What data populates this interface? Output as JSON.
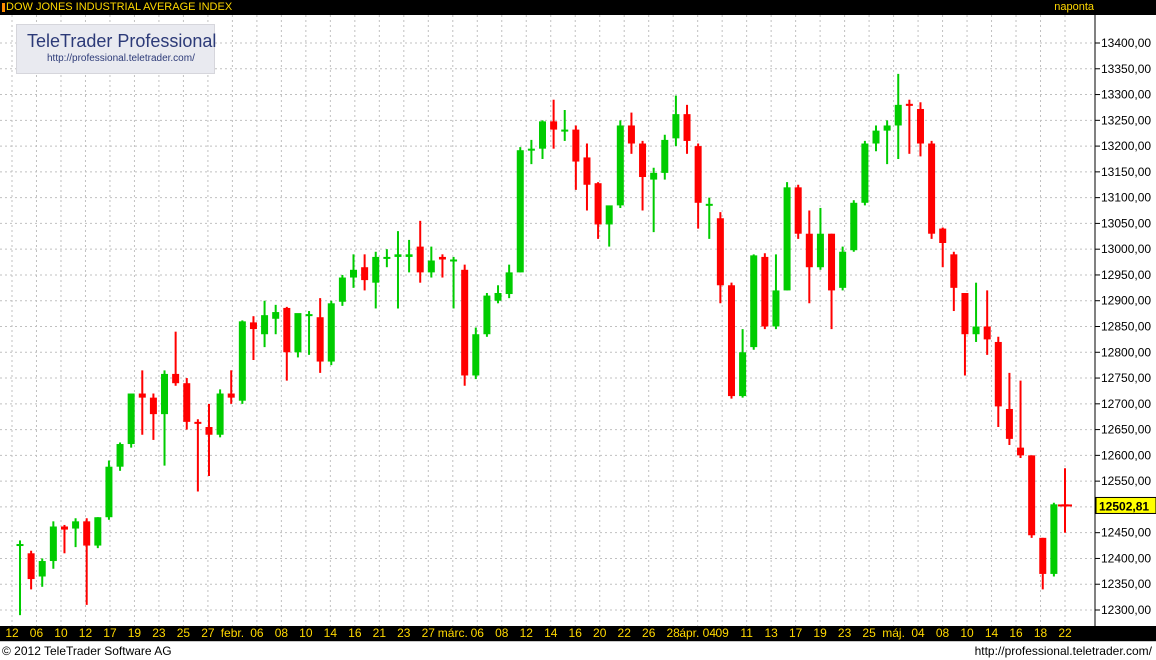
{
  "header": {
    "title": "DOW JONES INDUSTRIAL AVERAGE INDEX",
    "period": "naponta"
  },
  "logo": {
    "title": "TeleTrader Professional",
    "url": "http://professional.teletrader.com/"
  },
  "footer": {
    "copyright": "© 2012 TeleTrader Software AG",
    "url": "http://professional.teletrader.com/"
  },
  "colors": {
    "up": "#00cc00",
    "down": "#ff0000",
    "grid": "#c0c0c0",
    "label": "#ffd800",
    "last_bg": "#ffff00"
  },
  "chart_data": {
    "type": "candlestick",
    "title": "DOW JONES INDUSTRIAL AVERAGE INDEX",
    "ylim": [
      12280,
      13420
    ],
    "yticks": [
      12300,
      12350,
      12400,
      12450,
      12500,
      12550,
      12600,
      12650,
      12700,
      12750,
      12800,
      12850,
      12900,
      12950,
      13000,
      13050,
      13100,
      13150,
      13200,
      13250,
      13300,
      13350,
      13400
    ],
    "ytick_labels": [
      "12300,00",
      "12350,00",
      "12400,00",
      "12450,00",
      "12500,00",
      "12550,00",
      "12600,00",
      "12650,00",
      "12700,00",
      "12750,00",
      "12800,00",
      "12850,00",
      "12900,00",
      "12950,00",
      "13000,00",
      "13050,00",
      "13100,00",
      "13150,00",
      "13200,00",
      "13250,00",
      "13300,00",
      "13350,00",
      "13400,00"
    ],
    "xtick_labels": [
      "12",
      "06",
      "10",
      "12",
      "17",
      "19",
      "23",
      "25",
      "27",
      "febr.",
      "06",
      "08",
      "10",
      "14",
      "16",
      "21",
      "23",
      "27",
      "márc.",
      "06",
      "08",
      "12",
      "14",
      "16",
      "20",
      "22",
      "26",
      "28",
      "ápr. 04",
      "09",
      "11",
      "13",
      "17",
      "19",
      "23",
      "25",
      "máj.",
      "04",
      "08",
      "10",
      "14",
      "16",
      "18",
      "22"
    ],
    "last_value": 12502.81,
    "last_label": "12502,81",
    "grid": true,
    "candles": [
      {
        "o": 12428,
        "h": 12435,
        "l": 12290,
        "c": 12428
      },
      {
        "o": 12410,
        "h": 12415,
        "l": 12340,
        "c": 12360
      },
      {
        "o": 12365,
        "h": 12400,
        "l": 12345,
        "c": 12395
      },
      {
        "o": 12395,
        "h": 12472,
        "l": 12380,
        "c": 12462
      },
      {
        "o": 12462,
        "h": 12465,
        "l": 12410,
        "c": 12456
      },
      {
        "o": 12458,
        "h": 12478,
        "l": 12422,
        "c": 12472
      },
      {
        "o": 12472,
        "h": 12478,
        "l": 12310,
        "c": 12425
      },
      {
        "o": 12425,
        "h": 12480,
        "l": 12420,
        "c": 12480
      },
      {
        "o": 12480,
        "h": 12590,
        "l": 12475,
        "c": 12578
      },
      {
        "o": 12578,
        "h": 12625,
        "l": 12570,
        "c": 12622
      },
      {
        "o": 12622,
        "h": 12720,
        "l": 12615,
        "c": 12720
      },
      {
        "o": 12720,
        "h": 12765,
        "l": 12640,
        "c": 12712
      },
      {
        "o": 12712,
        "h": 12720,
        "l": 12630,
        "c": 12680
      },
      {
        "o": 12680,
        "h": 12765,
        "l": 12580,
        "c": 12758
      },
      {
        "o": 12758,
        "h": 12840,
        "l": 12735,
        "c": 12740
      },
      {
        "o": 12740,
        "h": 12750,
        "l": 12650,
        "c": 12665
      },
      {
        "o": 12665,
        "h": 12670,
        "l": 12530,
        "c": 12662
      },
      {
        "o": 12655,
        "h": 12700,
        "l": 12560,
        "c": 12640
      },
      {
        "o": 12640,
        "h": 12728,
        "l": 12635,
        "c": 12720
      },
      {
        "o": 12720,
        "h": 12765,
        "l": 12700,
        "c": 12712
      },
      {
        "o": 12706,
        "h": 12862,
        "l": 12700,
        "c": 12860
      },
      {
        "o": 12858,
        "h": 12870,
        "l": 12785,
        "c": 12845
      },
      {
        "o": 12835,
        "h": 12900,
        "l": 12810,
        "c": 12872
      },
      {
        "o": 12865,
        "h": 12892,
        "l": 12835,
        "c": 12878
      },
      {
        "o": 12886,
        "h": 12888,
        "l": 12745,
        "c": 12800
      },
      {
        "o": 12800,
        "h": 12875,
        "l": 12790,
        "c": 12876
      },
      {
        "o": 12872,
        "h": 12880,
        "l": 12795,
        "c": 12874
      },
      {
        "o": 12868,
        "h": 12905,
        "l": 12760,
        "c": 12782
      },
      {
        "o": 12782,
        "h": 12900,
        "l": 12775,
        "c": 12895
      },
      {
        "o": 12898,
        "h": 12950,
        "l": 12890,
        "c": 12945
      },
      {
        "o": 12945,
        "h": 12990,
        "l": 12925,
        "c": 12960
      },
      {
        "o": 12965,
        "h": 12990,
        "l": 12920,
        "c": 12940
      },
      {
        "o": 12935,
        "h": 12995,
        "l": 12885,
        "c": 12985
      },
      {
        "o": 12985,
        "h": 13000,
        "l": 12965,
        "c": 12985
      },
      {
        "o": 12985,
        "h": 13035,
        "l": 12885,
        "c": 12990
      },
      {
        "o": 12985,
        "h": 13018,
        "l": 12955,
        "c": 12990
      },
      {
        "o": 13005,
        "h": 13055,
        "l": 12935,
        "c": 12955
      },
      {
        "o": 12955,
        "h": 13005,
        "l": 12945,
        "c": 12978
      },
      {
        "o": 12985,
        "h": 12990,
        "l": 12945,
        "c": 12980
      },
      {
        "o": 12980,
        "h": 12985,
        "l": 12885,
        "c": 12980
      },
      {
        "o": 12960,
        "h": 12970,
        "l": 12735,
        "c": 12755
      },
      {
        "o": 12755,
        "h": 12848,
        "l": 12748,
        "c": 12835
      },
      {
        "o": 12835,
        "h": 12915,
        "l": 12830,
        "c": 12910
      },
      {
        "o": 12900,
        "h": 12930,
        "l": 12895,
        "c": 12915
      },
      {
        "o": 12913,
        "h": 12970,
        "l": 12905,
        "c": 12955
      },
      {
        "o": 12955,
        "h": 13198,
        "l": 12955,
        "c": 13192
      },
      {
        "o": 13192,
        "h": 13212,
        "l": 13165,
        "c": 13195
      },
      {
        "o": 13195,
        "h": 13250,
        "l": 13175,
        "c": 13248
      },
      {
        "o": 13248,
        "h": 13290,
        "l": 13195,
        "c": 13232
      },
      {
        "o": 13232,
        "h": 13270,
        "l": 13210,
        "c": 13232
      },
      {
        "o": 13232,
        "h": 13240,
        "l": 13115,
        "c": 13170
      },
      {
        "o": 13178,
        "h": 13205,
        "l": 13075,
        "c": 13125
      },
      {
        "o": 13128,
        "h": 13130,
        "l": 13020,
        "c": 13048
      },
      {
        "o": 13048,
        "h": 13075,
        "l": 13005,
        "c": 13085
      },
      {
        "o": 13085,
        "h": 13250,
        "l": 13080,
        "c": 13240
      },
      {
        "o": 13240,
        "h": 13265,
        "l": 13185,
        "c": 13205
      },
      {
        "o": 13205,
        "h": 13210,
        "l": 13075,
        "c": 13140
      },
      {
        "o": 13135,
        "h": 13158,
        "l": 13033,
        "c": 13148
      },
      {
        "o": 13148,
        "h": 13222,
        "l": 13135,
        "c": 13212
      },
      {
        "o": 13215,
        "h": 13298,
        "l": 13200,
        "c": 13262
      },
      {
        "o": 13262,
        "h": 13280,
        "l": 13185,
        "c": 13210
      },
      {
        "o": 13200,
        "h": 13205,
        "l": 13040,
        "c": 13090
      },
      {
        "o": 13088,
        "h": 13100,
        "l": 13020,
        "c": 13088
      },
      {
        "o": 13060,
        "h": 13072,
        "l": 12895,
        "c": 12930
      },
      {
        "o": 12930,
        "h": 12935,
        "l": 12710,
        "c": 12715
      },
      {
        "o": 12715,
        "h": 12845,
        "l": 12712,
        "c": 12800
      },
      {
        "o": 12810,
        "h": 12990,
        "l": 12805,
        "c": 12988
      },
      {
        "o": 12985,
        "h": 12992,
        "l": 12845,
        "c": 12850
      },
      {
        "o": 12850,
        "h": 12990,
        "l": 12845,
        "c": 12920
      },
      {
        "o": 12920,
        "h": 13130,
        "l": 12920,
        "c": 13120
      },
      {
        "o": 13120,
        "h": 13125,
        "l": 13020,
        "c": 13030
      },
      {
        "o": 13030,
        "h": 13075,
        "l": 12895,
        "c": 12965
      },
      {
        "o": 12965,
        "h": 13080,
        "l": 12960,
        "c": 13030
      },
      {
        "o": 13030,
        "h": 13030,
        "l": 12845,
        "c": 12920
      },
      {
        "o": 12925,
        "h": 13005,
        "l": 12920,
        "c": 12995
      },
      {
        "o": 12998,
        "h": 13095,
        "l": 12995,
        "c": 13090
      },
      {
        "o": 13090,
        "h": 13210,
        "l": 13085,
        "c": 13205
      },
      {
        "o": 13205,
        "h": 13240,
        "l": 13190,
        "c": 13230
      },
      {
        "o": 13230,
        "h": 13250,
        "l": 13165,
        "c": 13240
      },
      {
        "o": 13240,
        "h": 13340,
        "l": 13175,
        "c": 13280
      },
      {
        "o": 13282,
        "h": 13290,
        "l": 13185,
        "c": 13278
      },
      {
        "o": 13272,
        "h": 13285,
        "l": 13180,
        "c": 13205
      },
      {
        "o": 13205,
        "h": 13210,
        "l": 13020,
        "c": 13030
      },
      {
        "o": 13040,
        "h": 13042,
        "l": 12965,
        "c": 13012
      },
      {
        "o": 12990,
        "h": 12995,
        "l": 12880,
        "c": 12925
      },
      {
        "o": 12915,
        "h": 12915,
        "l": 12755,
        "c": 12835
      },
      {
        "o": 12835,
        "h": 12935,
        "l": 12820,
        "c": 12850
      },
      {
        "o": 12850,
        "h": 12920,
        "l": 12795,
        "c": 12825
      },
      {
        "o": 12820,
        "h": 12830,
        "l": 12655,
        "c": 12695
      },
      {
        "o": 12690,
        "h": 12760,
        "l": 12620,
        "c": 12632
      },
      {
        "o": 12615,
        "h": 12745,
        "l": 12595,
        "c": 12600
      },
      {
        "o": 12600,
        "h": 12600,
        "l": 12440,
        "c": 12445
      },
      {
        "o": 12440,
        "h": 12440,
        "l": 12340,
        "c": 12370
      },
      {
        "o": 12370,
        "h": 12508,
        "l": 12365,
        "c": 12505
      },
      {
        "o": 12505,
        "h": 12575,
        "l": 12450,
        "c": 12503
      }
    ]
  }
}
